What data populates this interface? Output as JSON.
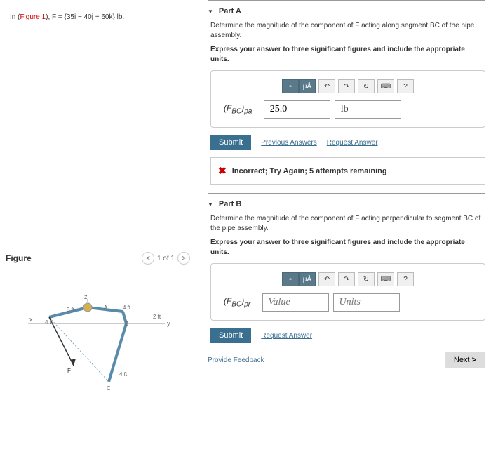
{
  "problem": {
    "prefix": "In (",
    "link": "Figure 1",
    "suffix": "), F = {35i − 40j + 60k} lb."
  },
  "figure": {
    "title": "Figure",
    "nav": "1 of 1"
  },
  "partA": {
    "title": "Part A",
    "prompt": "Determine the magnitude of the component of F acting along segment BC of the pipe assembly.",
    "instruct": "Express your answer to three significant figures and include the appropriate units.",
    "var_label": "(F_BC)_pa =",
    "value": "25.0",
    "units": "lb",
    "submit": "Submit",
    "prev_answers": "Previous Answers",
    "req_answer": "Request Answer",
    "feedback": "Incorrect; Try Again; 5 attempts remaining"
  },
  "partB": {
    "title": "Part B",
    "prompt": "Determine the magnitude of the component of F acting perpendicular to segment BC of the pipe assembly.",
    "instruct": "Express your answer to three significant figures and include the appropriate units.",
    "var_label": "(F_BC)_pr =",
    "value_placeholder": "Value",
    "units_placeholder": "Units",
    "submit": "Submit",
    "req_answer": "Request Answer"
  },
  "provide_feedback": "Provide Feedback",
  "next": "Next",
  "toolbar": {
    "help": "?"
  }
}
